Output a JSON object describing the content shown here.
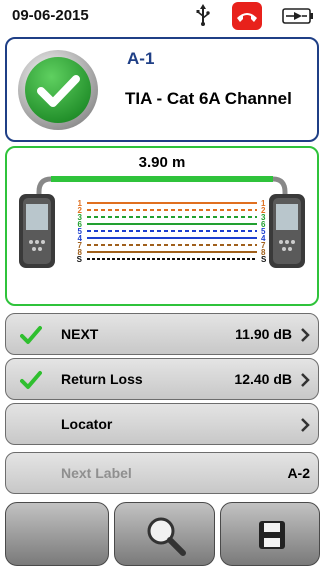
{
  "status": {
    "date": "09-06-2015",
    "icons": [
      "usb-icon",
      "phone-hangup-icon",
      "battery-icon"
    ],
    "phone_color": "#e8211b"
  },
  "result": {
    "status": "pass",
    "id": "A-1",
    "standard": "TIA - Cat 6A Channel",
    "border_color": "#1f3f86",
    "pass_color": "#2aa532"
  },
  "wiremap": {
    "length": "3.90 m",
    "border_color": "#2fc33b",
    "pins": [
      "1",
      "2",
      "3",
      "6",
      "5",
      "4",
      "7",
      "8",
      "S"
    ]
  },
  "results": [
    {
      "label": "NEXT",
      "value": "11.90 dB",
      "passed": true
    },
    {
      "label": "Return Loss",
      "value": "12.40 dB",
      "passed": true
    },
    {
      "label": "Locator",
      "value": ""
    }
  ],
  "next_label": {
    "label": "Next Label",
    "value": "A-2"
  },
  "bottom_bar": {
    "buttons": [
      "blank",
      "magnifier-icon",
      "save-icon"
    ]
  }
}
